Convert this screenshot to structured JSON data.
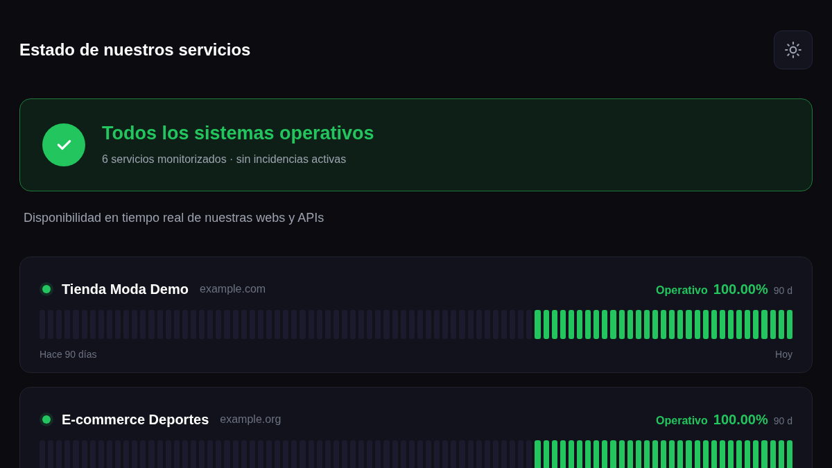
{
  "header": {
    "title": "Estado de nuestros servicios"
  },
  "summary": {
    "title": "Todos los sistemas operativos",
    "subtitle": "6 servicios monitorizados · sin incidencias activas",
    "all_operational": true
  },
  "intro": "Disponibilidad en tiempo real de nuestras webs y APIs",
  "services": [
    {
      "name": "Tienda Moda Demo",
      "domain": "example.com",
      "color": "#22c55e",
      "status_label": "Operativo",
      "uptime": "100.00%",
      "period": "90 d",
      "start_label": "Hace 90 días",
      "end_label": "Hoy",
      "days": [
        {
          "up": false
        },
        {
          "up": false
        },
        {
          "up": false
        },
        {
          "up": false
        },
        {
          "up": false
        },
        {
          "up": false
        },
        {
          "up": false
        },
        {
          "up": false
        },
        {
          "up": false
        },
        {
          "up": false
        },
        {
          "up": false
        },
        {
          "up": false
        },
        {
          "up": false
        },
        {
          "up": false
        },
        {
          "up": false
        },
        {
          "up": false
        },
        {
          "up": false
        },
        {
          "up": false
        },
        {
          "up": false
        },
        {
          "up": false
        },
        {
          "up": false
        },
        {
          "up": false
        },
        {
          "up": false
        },
        {
          "up": false
        },
        {
          "up": false
        },
        {
          "up": false
        },
        {
          "up": false
        },
        {
          "up": false
        },
        {
          "up": false
        },
        {
          "up": false
        },
        {
          "up": false
        },
        {
          "up": false
        },
        {
          "up": false
        },
        {
          "up": false
        },
        {
          "up": false
        },
        {
          "up": false
        },
        {
          "up": false
        },
        {
          "up": false
        },
        {
          "up": false
        },
        {
          "up": false
        },
        {
          "up": false
        },
        {
          "up": false
        },
        {
          "up": false
        },
        {
          "up": false
        },
        {
          "up": false
        },
        {
          "up": false
        },
        {
          "up": false
        },
        {
          "up": false
        },
        {
          "up": false
        },
        {
          "up": false
        },
        {
          "up": false
        },
        {
          "up": false
        },
        {
          "up": false
        },
        {
          "up": false
        },
        {
          "up": false
        },
        {
          "up": false
        },
        {
          "up": false
        },
        {
          "up": false
        },
        {
          "up": false
        },
        {
          "up": true
        },
        {
          "up": true
        },
        {
          "up": true
        },
        {
          "up": true
        },
        {
          "up": true
        },
        {
          "up": true
        },
        {
          "up": true
        },
        {
          "up": true
        },
        {
          "up": true
        },
        {
          "up": true
        },
        {
          "up": true
        },
        {
          "up": true
        },
        {
          "up": true
        },
        {
          "up": true
        },
        {
          "up": true
        },
        {
          "up": true
        },
        {
          "up": true
        },
        {
          "up": true
        },
        {
          "up": true
        },
        {
          "up": true
        },
        {
          "up": true
        },
        {
          "up": true
        },
        {
          "up": true
        },
        {
          "up": true
        },
        {
          "up": true
        },
        {
          "up": true
        },
        {
          "up": true
        },
        {
          "up": true
        },
        {
          "up": true
        },
        {
          "up": true
        },
        {
          "up": true
        }
      ]
    },
    {
      "name": "E-commerce Deportes",
      "domain": "example.org",
      "color": "#22c55e",
      "status_label": "Operativo",
      "uptime": "100.00%",
      "period": "90 d",
      "days": [
        {
          "up": false
        },
        {
          "up": false
        },
        {
          "up": false
        },
        {
          "up": false
        },
        {
          "up": false
        },
        {
          "up": false
        },
        {
          "up": false
        },
        {
          "up": false
        },
        {
          "up": false
        },
        {
          "up": false
        },
        {
          "up": false
        },
        {
          "up": false
        },
        {
          "up": false
        },
        {
          "up": false
        },
        {
          "up": false
        },
        {
          "up": false
        },
        {
          "up": false
        },
        {
          "up": false
        },
        {
          "up": false
        },
        {
          "up": false
        },
        {
          "up": false
        },
        {
          "up": false
        },
        {
          "up": false
        },
        {
          "up": false
        },
        {
          "up": false
        },
        {
          "up": false
        },
        {
          "up": false
        },
        {
          "up": false
        },
        {
          "up": false
        },
        {
          "up": false
        },
        {
          "up": false
        },
        {
          "up": false
        },
        {
          "up": false
        },
        {
          "up": false
        },
        {
          "up": false
        },
        {
          "up": false
        },
        {
          "up": false
        },
        {
          "up": false
        },
        {
          "up": false
        },
        {
          "up": false
        },
        {
          "up": false
        },
        {
          "up": false
        },
        {
          "up": false
        },
        {
          "up": false
        },
        {
          "up": false
        },
        {
          "up": false
        },
        {
          "up": false
        },
        {
          "up": false
        },
        {
          "up": false
        },
        {
          "up": false
        },
        {
          "up": false
        },
        {
          "up": false
        },
        {
          "up": false
        },
        {
          "up": false
        },
        {
          "up": false
        },
        {
          "up": false
        },
        {
          "up": false
        },
        {
          "up": false
        },
        {
          "up": false
        },
        {
          "up": true
        },
        {
          "up": true
        },
        {
          "up": true
        },
        {
          "up": true
        },
        {
          "up": true
        },
        {
          "up": true
        },
        {
          "up": true
        },
        {
          "up": true
        },
        {
          "up": true
        },
        {
          "up": true
        },
        {
          "up": true
        },
        {
          "up": true
        },
        {
          "up": true
        },
        {
          "up": true
        },
        {
          "up": true
        },
        {
          "up": true
        },
        {
          "up": true
        },
        {
          "up": true
        },
        {
          "up": true
        },
        {
          "up": true
        },
        {
          "up": true
        },
        {
          "up": true
        },
        {
          "up": true
        },
        {
          "up": true
        },
        {
          "up": true
        },
        {
          "up": true
        },
        {
          "up": true
        },
        {
          "up": true
        },
        {
          "up": true
        },
        {
          "up": true
        },
        {
          "up": true
        }
      ]
    }
  ]
}
